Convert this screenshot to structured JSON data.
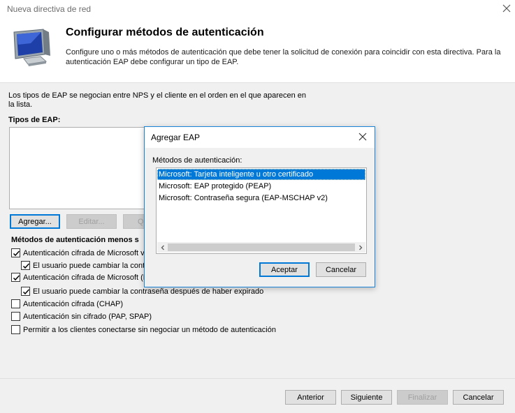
{
  "window": {
    "title": "Nueva directiva de red"
  },
  "header": {
    "title": "Configurar métodos de autenticación",
    "description": "Configure uno o más métodos de autenticación que debe tener la solicitud de conexión para coincidir con esta directiva. Para la autenticación EAP debe configurar un tipo de EAP."
  },
  "main": {
    "intro": "Los tipos de EAP se negocian entre NPS y el cliente en el orden en el que aparecen en la lista.",
    "eap_types_label": "Tipos de EAP:",
    "buttons": {
      "add": "Agregar...",
      "edit": "Editar...",
      "remove_partial": "Qu"
    },
    "less_secure_label": "Métodos de autenticación menos s",
    "checkboxes": [
      {
        "label": "Autenticación cifrada de Microsoft ve",
        "checked": true
      },
      {
        "label": "El usuario puede cambiar la contras",
        "checked": true
      },
      {
        "label": "Autenticación cifrada de Microsoft (M",
        "checked": true
      },
      {
        "label": "El usuario puede cambiar la contraseña después de haber expirado",
        "checked": true
      },
      {
        "label": "Autenticación cifrada (CHAP)",
        "checked": false
      },
      {
        "label": "Autenticación sin cifrado (PAP, SPAP)",
        "checked": false
      },
      {
        "label": "Permitir a los clientes conectarse sin negociar un método de autenticación",
        "checked": false
      }
    ]
  },
  "dialog": {
    "title": "Agregar EAP",
    "methods_label": "Métodos de autenticación:",
    "methods": [
      "Microsoft: Tarjeta inteligente u otro certificado",
      "Microsoft: EAP protegido (PEAP)",
      "Microsoft: Contraseña segura (EAP-MSCHAP v2)"
    ],
    "selected_index": 0,
    "accept_label": "Aceptar",
    "cancel_label": "Cancelar"
  },
  "footer": {
    "back": "Anterior",
    "next": "Siguiente",
    "finish": "Finalizar",
    "cancel": "Cancelar"
  },
  "colors": {
    "accent": "#0078d7",
    "panel": "#f0f0f0"
  },
  "icons": {
    "close": "close-icon",
    "wizard": "monitor-icon",
    "scroll_left": "chevron-left-icon",
    "scroll_right": "chevron-right-icon",
    "check": "checkmark-icon"
  }
}
